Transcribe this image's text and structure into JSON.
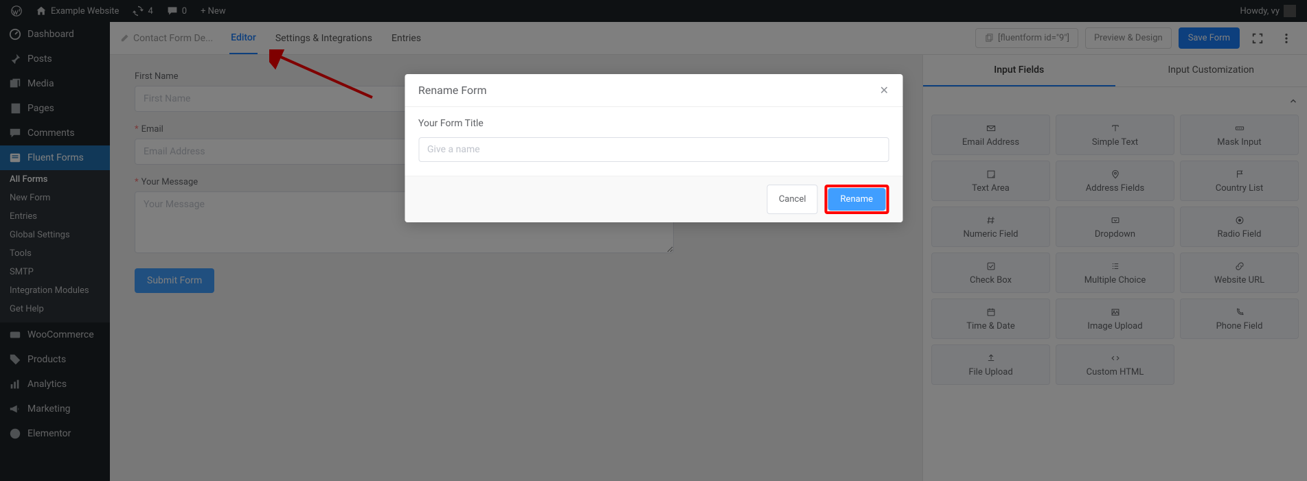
{
  "adminbar": {
    "site_name": "Example Website",
    "updates": "4",
    "comments": "0",
    "new": "+ New",
    "howdy": "Howdy, vy"
  },
  "sidebar": {
    "items": [
      {
        "label": "Dashboard",
        "icon": "dashboard"
      },
      {
        "label": "Posts",
        "icon": "pin"
      },
      {
        "label": "Media",
        "icon": "media"
      },
      {
        "label": "Pages",
        "icon": "pages"
      },
      {
        "label": "Comments",
        "icon": "comment"
      },
      {
        "label": "Fluent Forms",
        "icon": "form",
        "active": true
      },
      {
        "label": "WooCommerce",
        "icon": "woo"
      },
      {
        "label": "Products",
        "icon": "products"
      },
      {
        "label": "Analytics",
        "icon": "analytics"
      },
      {
        "label": "Marketing",
        "icon": "marketing"
      },
      {
        "label": "Elementor",
        "icon": "elementor"
      }
    ],
    "submenu": [
      {
        "label": "All Forms",
        "current": true
      },
      {
        "label": "New Form"
      },
      {
        "label": "Entries"
      },
      {
        "label": "Global Settings"
      },
      {
        "label": "Tools"
      },
      {
        "label": "SMTP"
      },
      {
        "label": "Integration Modules"
      },
      {
        "label": "Get Help"
      }
    ]
  },
  "toolbar": {
    "form_name": "Contact Form De...",
    "tabs": [
      {
        "label": "Editor",
        "active": true
      },
      {
        "label": "Settings & Integrations"
      },
      {
        "label": "Entries"
      }
    ],
    "shortcode": "[fluentform id=\"9\"]",
    "preview": "Preview & Design",
    "save": "Save Form"
  },
  "form": {
    "fields": [
      {
        "label": "First Name",
        "placeholder": "First Name",
        "required": false,
        "type": "text"
      },
      {
        "label": "Email",
        "placeholder": "Email Address",
        "required": true,
        "type": "text"
      },
      {
        "label": "Your Message",
        "placeholder": "Your Message",
        "required": true,
        "type": "textarea"
      }
    ],
    "submit": "Submit Form"
  },
  "right_panel": {
    "tabs": [
      "Input Fields",
      "Input Customization"
    ],
    "grid": [
      {
        "label": "Email Address",
        "icon": "mail"
      },
      {
        "label": "Simple Text",
        "icon": "text"
      },
      {
        "label": "Mask Input",
        "icon": "mask"
      },
      {
        "label": "Text Area",
        "icon": "textarea"
      },
      {
        "label": "Address Fields",
        "icon": "location"
      },
      {
        "label": "Country List",
        "icon": "flag"
      },
      {
        "label": "Numeric Field",
        "icon": "hash"
      },
      {
        "label": "Dropdown",
        "icon": "dropdown"
      },
      {
        "label": "Radio Field",
        "icon": "radio"
      },
      {
        "label": "Check Box",
        "icon": "checkbox"
      },
      {
        "label": "Multiple Choice",
        "icon": "multi"
      },
      {
        "label": "Website URL",
        "icon": "link"
      },
      {
        "label": "Time & Date",
        "icon": "calendar"
      },
      {
        "label": "Image Upload",
        "icon": "image"
      },
      {
        "label": "Phone Field",
        "icon": "phone"
      },
      {
        "label": "File Upload",
        "icon": "upload"
      },
      {
        "label": "Custom HTML",
        "icon": "code"
      }
    ]
  },
  "modal": {
    "title": "Rename Form",
    "label": "Your Form Title",
    "placeholder": "Give a name",
    "cancel": "Cancel",
    "rename": "Rename"
  }
}
